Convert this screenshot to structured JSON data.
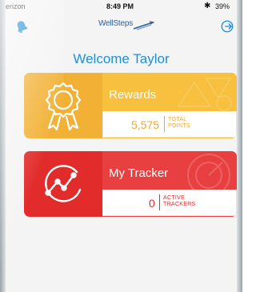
{
  "statusbar": {
    "carrier": "erizon",
    "time": "8:49 PM",
    "battery": "39%"
  },
  "appbar": {
    "logo_text": "WellSteps",
    "left_icon": "bell-icon",
    "right_icon": "logout-icon"
  },
  "welcome": "Welcome Taylor",
  "cards": {
    "rewards": {
      "title": "Rewards",
      "value": "5,575",
      "label_line1": "TOTAL",
      "label_line2": "POINTS",
      "icon": "award-ribbon-icon"
    },
    "tracker": {
      "title": "My Tracker",
      "value": "0",
      "label_line1": "ACTIVE",
      "label_line2": "TRACKERS",
      "icon": "trend-chart-icon"
    }
  },
  "colors": {
    "accent_blue": "#1f8fd8",
    "rewards_orange": "#f2b135",
    "tracker_red": "#e22b2b"
  }
}
